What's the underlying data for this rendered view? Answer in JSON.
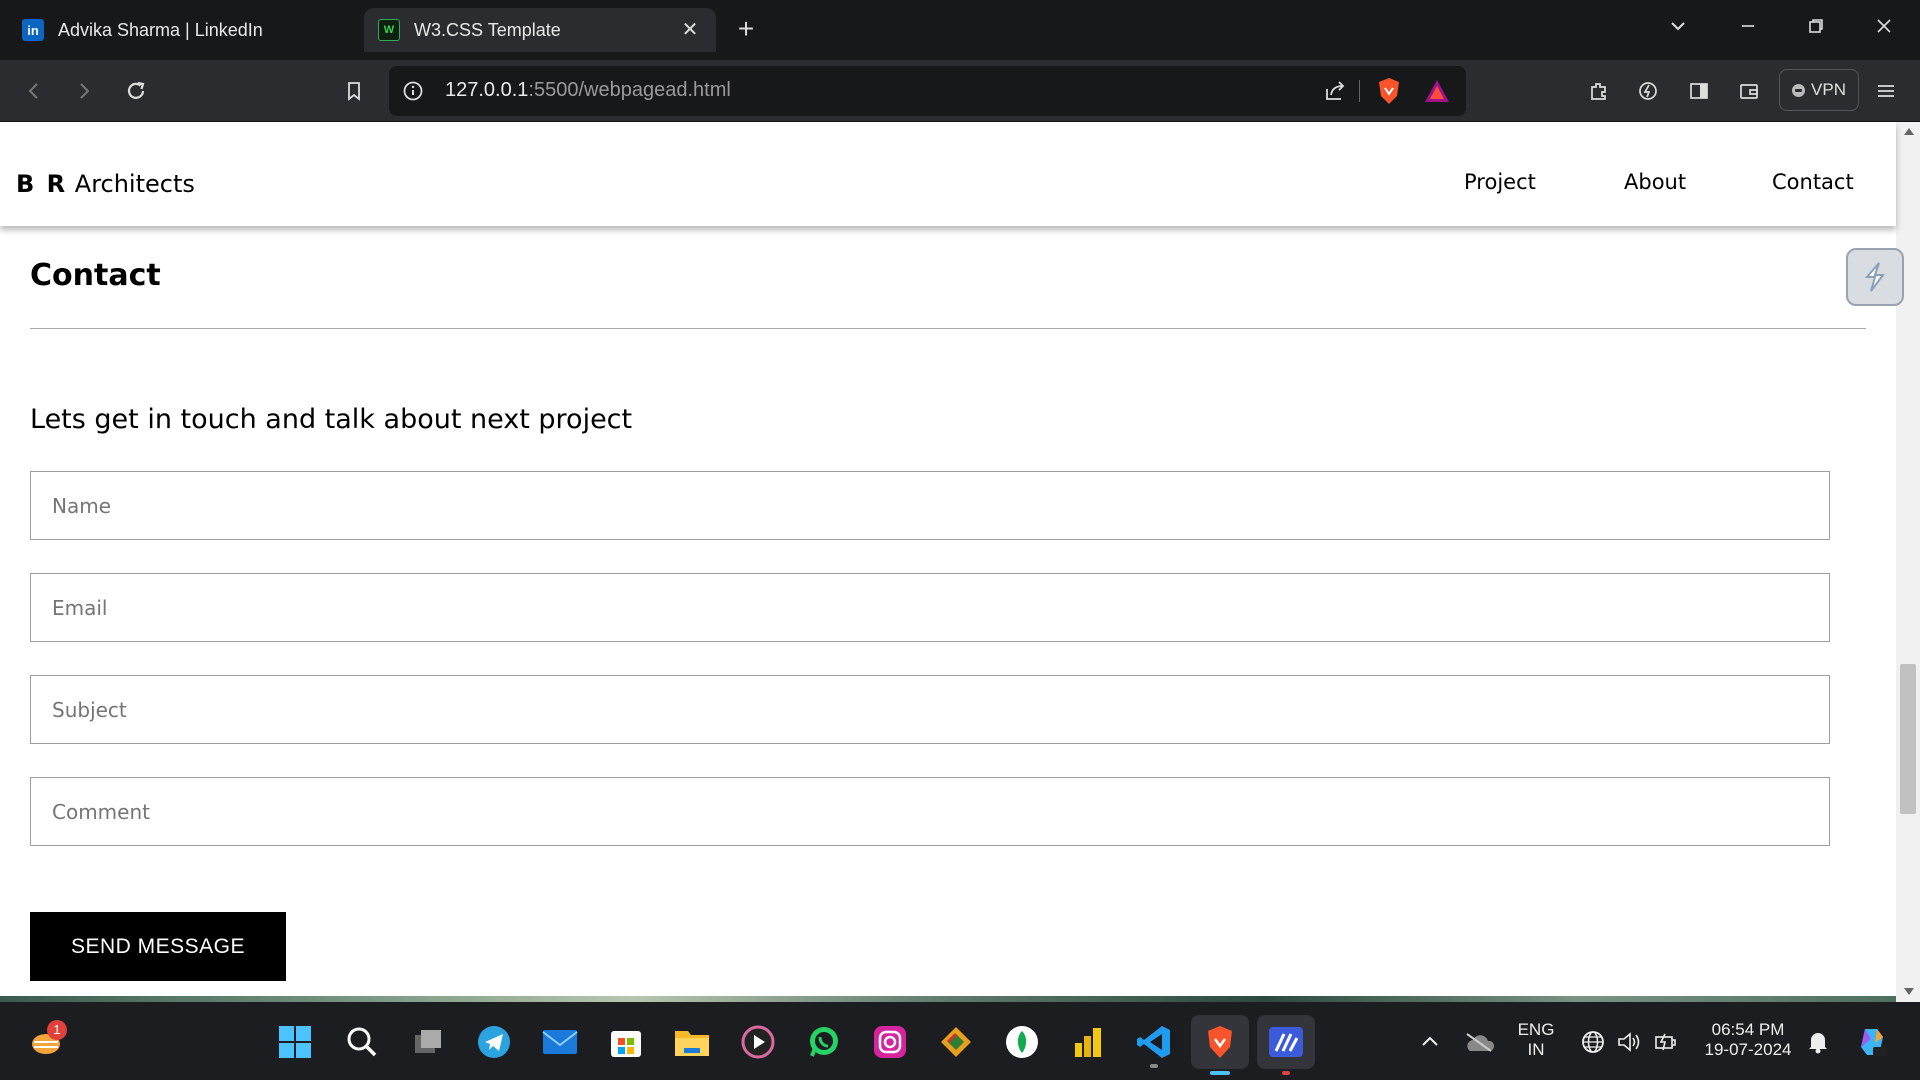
{
  "browser": {
    "tabs": [
      {
        "title": "Advika Sharma | LinkedIn",
        "favicon": "linkedin-icon",
        "active": false
      },
      {
        "title": "W3.CSS Template",
        "favicon": "w3css-icon",
        "active": true
      }
    ],
    "new_tab_label": "+",
    "url_host": "127.0.0.1",
    "url_rest": ":5500/webpagead.html",
    "vpn_label": "VPN"
  },
  "site": {
    "logo_bold": "B R",
    "logo_rest": " Architects",
    "nav": [
      "Project",
      "About",
      "Contact"
    ]
  },
  "contact": {
    "title": "Contact",
    "lead": "Lets get in touch and talk about next project",
    "placeholders": {
      "name": "Name",
      "email": "Email",
      "subject": "Subject",
      "comment": "Comment"
    },
    "send_label": "SEND MESSAGE"
  },
  "taskbar": {
    "notification_count": "1",
    "language": "ENG",
    "region": "IN",
    "time": "06:54 PM",
    "date": "19-07-2024",
    "apps": [
      "windows-start-icon",
      "search-icon",
      "task-view-icon",
      "telegram-icon",
      "mail-icon",
      "store-icon",
      "file-explorer-icon",
      "media-player-icon",
      "whatsapp-icon",
      "instagram-icon",
      "git-icon",
      "mongodb-icon",
      "power-bi-icon",
      "vscode-icon",
      "brave-icon",
      "mystery-app-icon"
    ]
  },
  "colors": {
    "send_button": "#000000",
    "tab_bar": "#17181a",
    "toolbar": "#2a2c30",
    "taskbar": "#1c1d20"
  }
}
